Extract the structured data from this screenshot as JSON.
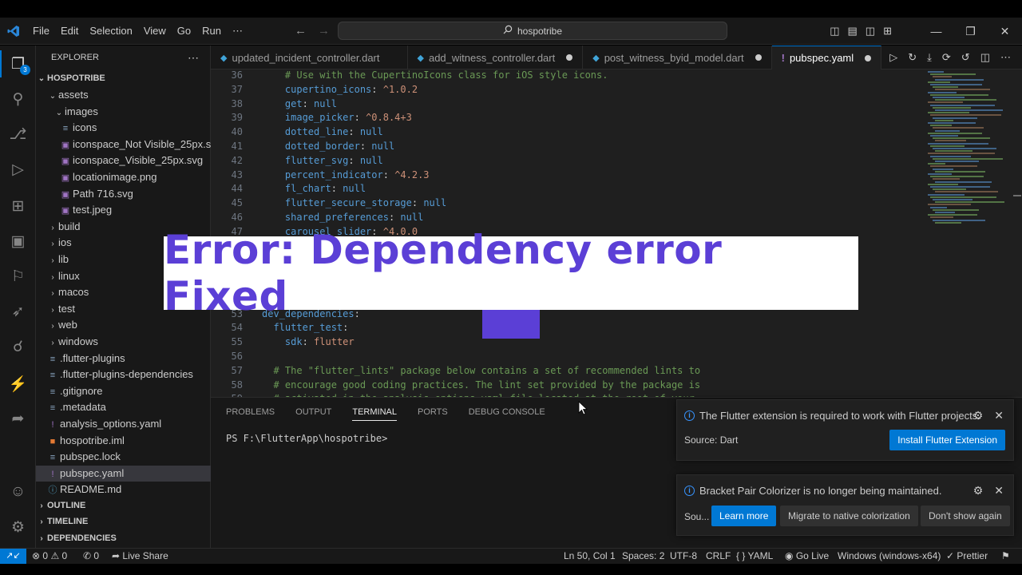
{
  "menu": [
    "File",
    "Edit",
    "Selection",
    "View",
    "Go",
    "Run",
    "⋯"
  ],
  "search": {
    "label": "hospotribe"
  },
  "explorer": {
    "title": "EXPLORER",
    "root": "HOSPOTRIBE",
    "items": [
      {
        "label": "assets",
        "kind": "folder-open",
        "indent": 1
      },
      {
        "label": "images",
        "kind": "folder-open",
        "indent": 2
      },
      {
        "label": "icons",
        "kind": "file-list",
        "indent": 3
      },
      {
        "label": "iconspace_Not Visible_25px.svg",
        "kind": "svg",
        "indent": 3
      },
      {
        "label": "iconspace_Visible_25px.svg",
        "kind": "svg",
        "indent": 3
      },
      {
        "label": "locationimage.png",
        "kind": "image",
        "indent": 3
      },
      {
        "label": "Path 716.svg",
        "kind": "svg",
        "indent": 3
      },
      {
        "label": "test.jpeg",
        "kind": "image",
        "indent": 3
      },
      {
        "label": "build",
        "kind": "folder",
        "indent": 1
      },
      {
        "label": "ios",
        "kind": "folder",
        "indent": 1
      },
      {
        "label": "lib",
        "kind": "folder",
        "indent": 1
      },
      {
        "label": "linux",
        "kind": "folder",
        "indent": 1
      },
      {
        "label": "macos",
        "kind": "folder",
        "indent": 1
      },
      {
        "label": "test",
        "kind": "folder",
        "indent": 1
      },
      {
        "label": "web",
        "kind": "folder",
        "indent": 1
      },
      {
        "label": "windows",
        "kind": "folder",
        "indent": 1
      },
      {
        "label": ".flutter-plugins",
        "kind": "file-list",
        "indent": 1
      },
      {
        "label": ".flutter-plugins-dependencies",
        "kind": "file-list",
        "indent": 1
      },
      {
        "label": ".gitignore",
        "kind": "file-list",
        "indent": 1
      },
      {
        "label": ".metadata",
        "kind": "file-list",
        "indent": 1
      },
      {
        "label": "analysis_options.yaml",
        "kind": "yaml",
        "indent": 1
      },
      {
        "label": "hospotribe.iml",
        "kind": "iml",
        "indent": 1
      },
      {
        "label": "pubspec.lock",
        "kind": "file-list",
        "indent": 1
      },
      {
        "label": "pubspec.yaml",
        "kind": "yaml",
        "indent": 1,
        "selected": true
      },
      {
        "label": "README.md",
        "kind": "info",
        "indent": 1
      }
    ],
    "sections": [
      "OUTLINE",
      "TIMELINE",
      "DEPENDENCIES"
    ]
  },
  "tabs": [
    {
      "label": "updated_incident_controller.dart",
      "modified": false
    },
    {
      "label": "add_witness_controller.dart",
      "modified": true
    },
    {
      "label": "post_witness_byid_model.dart",
      "modified": true
    },
    {
      "label": "pubspec.yaml",
      "modified": true,
      "active": true
    }
  ],
  "code": [
    {
      "n": "36",
      "parts": [
        {
          "t": "    ",
          "c": "p"
        },
        {
          "t": "# Use with the CupertinoIcons class for iOS style icons.",
          "c": "c"
        }
      ]
    },
    {
      "n": "37",
      "parts": [
        {
          "t": "    ",
          "c": "p"
        },
        {
          "t": "cupertino_icons",
          "c": "k"
        },
        {
          "t": ": ",
          "c": "p"
        },
        {
          "t": "^1.0.2",
          "c": "s"
        }
      ]
    },
    {
      "n": "38",
      "parts": [
        {
          "t": "    ",
          "c": "p"
        },
        {
          "t": "get",
          "c": "k"
        },
        {
          "t": ": ",
          "c": "p"
        },
        {
          "t": "null",
          "c": "v"
        }
      ]
    },
    {
      "n": "39",
      "parts": [
        {
          "t": "    ",
          "c": "p"
        },
        {
          "t": "image_picker",
          "c": "k"
        },
        {
          "t": ": ",
          "c": "p"
        },
        {
          "t": "^0.8.4+3",
          "c": "s"
        }
      ]
    },
    {
      "n": "40",
      "parts": [
        {
          "t": "    ",
          "c": "p"
        },
        {
          "t": "dotted_line",
          "c": "k"
        },
        {
          "t": ": ",
          "c": "p"
        },
        {
          "t": "null",
          "c": "v"
        }
      ]
    },
    {
      "n": "41",
      "parts": [
        {
          "t": "    ",
          "c": "p"
        },
        {
          "t": "dotted_border",
          "c": "k"
        },
        {
          "t": ": ",
          "c": "p"
        },
        {
          "t": "null",
          "c": "v"
        }
      ]
    },
    {
      "n": "42",
      "parts": [
        {
          "t": "    ",
          "c": "p"
        },
        {
          "t": "flutter_svg",
          "c": "k"
        },
        {
          "t": ": ",
          "c": "p"
        },
        {
          "t": "null",
          "c": "v"
        }
      ]
    },
    {
      "n": "43",
      "parts": [
        {
          "t": "    ",
          "c": "p"
        },
        {
          "t": "percent_indicator",
          "c": "k"
        },
        {
          "t": ": ",
          "c": "p"
        },
        {
          "t": "^4.2.3",
          "c": "s"
        }
      ]
    },
    {
      "n": "44",
      "parts": [
        {
          "t": "    ",
          "c": "p"
        },
        {
          "t": "fl_chart",
          "c": "k"
        },
        {
          "t": ": ",
          "c": "p"
        },
        {
          "t": "null",
          "c": "v"
        }
      ]
    },
    {
      "n": "45",
      "parts": [
        {
          "t": "    ",
          "c": "p"
        },
        {
          "t": "flutter_secure_storage",
          "c": "k"
        },
        {
          "t": ": ",
          "c": "p"
        },
        {
          "t": "null",
          "c": "v"
        }
      ]
    },
    {
      "n": "46",
      "parts": [
        {
          "t": "    ",
          "c": "p"
        },
        {
          "t": "shared_preferences",
          "c": "k"
        },
        {
          "t": ": ",
          "c": "p"
        },
        {
          "t": "null",
          "c": "v"
        }
      ]
    },
    {
      "n": "47",
      "parts": [
        {
          "t": "    ",
          "c": "p"
        },
        {
          "t": "carousel_slider",
          "c": "k"
        },
        {
          "t": ": ",
          "c": "p"
        },
        {
          "t": "^4.0.0",
          "c": "s"
        }
      ]
    },
    {
      "n": "53",
      "parts": [
        {
          "t": "dev_dependencies",
          "c": "k"
        },
        {
          "t": ":",
          "c": "p"
        }
      ]
    },
    {
      "n": "54",
      "parts": [
        {
          "t": "  ",
          "c": "p"
        },
        {
          "t": "flutter_test",
          "c": "k"
        },
        {
          "t": ":",
          "c": "p"
        }
      ]
    },
    {
      "n": "55",
      "parts": [
        {
          "t": "    ",
          "c": "p"
        },
        {
          "t": "sdk",
          "c": "k"
        },
        {
          "t": ": ",
          "c": "p"
        },
        {
          "t": "flutter",
          "c": "s"
        }
      ]
    },
    {
      "n": "56",
      "parts": []
    },
    {
      "n": "57",
      "parts": [
        {
          "t": "  ",
          "c": "p"
        },
        {
          "t": "# The \"flutter_lints\" package below contains a set of recommended lints to",
          "c": "c"
        }
      ]
    },
    {
      "n": "58",
      "parts": [
        {
          "t": "  ",
          "c": "p"
        },
        {
          "t": "# encourage good coding practices. The lint set provided by the package is",
          "c": "c"
        }
      ]
    },
    {
      "n": "59",
      "parts": [
        {
          "t": "  ",
          "c": "p"
        },
        {
          "t": "# activated in the analysis_options.yaml file located at the root of your",
          "c": "c"
        }
      ]
    }
  ],
  "banner": {
    "text": "Error: Dependency error Fixed"
  },
  "panel": {
    "tabs": [
      "PROBLEMS",
      "OUTPUT",
      "TERMINAL",
      "PORTS",
      "DEBUG CONSOLE"
    ],
    "active": "TERMINAL",
    "prompt": "PS F:\\FlutterApp\\hospotribe>"
  },
  "notifications": [
    {
      "message": "The Flutter extension is required to work with Flutter projects.",
      "source": "Source: Dart",
      "buttons": [
        "Install Flutter Extension"
      ]
    },
    {
      "message": "Bracket Pair Colorizer is no longer being maintained.",
      "source": "Sou...",
      "buttons": [
        "Learn more",
        "Migrate to native colorization",
        "Don't show again"
      ]
    }
  ],
  "status": {
    "errors": "0",
    "warnings": "0",
    "ports": "0",
    "live_share": "Live Share",
    "position": "Ln 50, Col 1",
    "spaces": "Spaces: 2",
    "encoding": "UTF-8",
    "eol": "CRLF",
    "language": "YAML",
    "golive": "Go Live",
    "platform": "Windows (windows-x64)",
    "prettier": "Prettier"
  },
  "colors": {
    "accent": "#0078d4",
    "banner_text": "#5b3fd6",
    "editor_bg": "#1f1f1f",
    "sidebar_bg": "#181818"
  }
}
